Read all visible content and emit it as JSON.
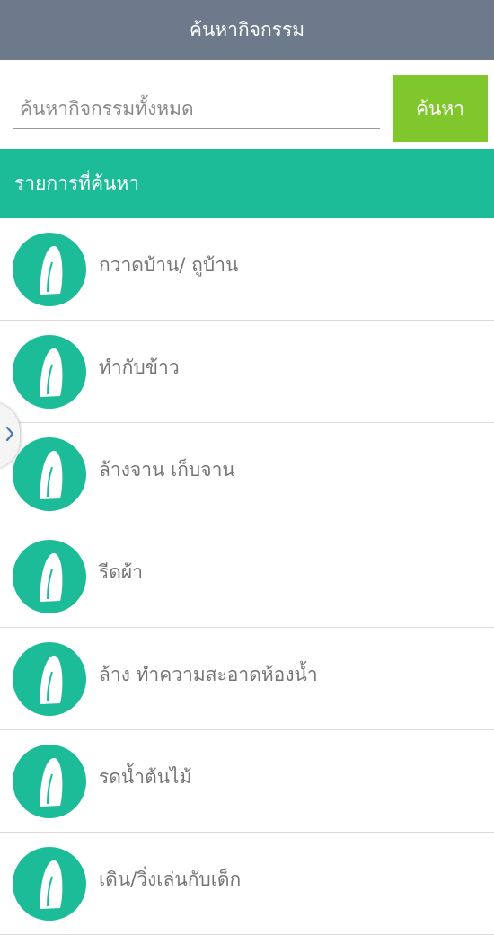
{
  "header": {
    "title": "ค้นหากิจกรรม"
  },
  "search": {
    "placeholder": "ค้นหากิจกรรมทั้งหมด",
    "value": "",
    "button_label": "ค้นหา"
  },
  "results_header": {
    "label": "รายการที่ค้นหา"
  },
  "items": [
    {
      "label": "กวาดบ้าน/ ถูบ้าน",
      "icon": "iron-icon"
    },
    {
      "label": "ทำกับข้าว",
      "icon": "iron-icon"
    },
    {
      "label": "ล้างจาน เก็บจาน",
      "icon": "iron-icon"
    },
    {
      "label": "รีดผ้า",
      "icon": "iron-icon"
    },
    {
      "label": "ล้าง ทำความสะอาดห้องน้ำ",
      "icon": "iron-icon"
    },
    {
      "label": "รดน้ำต้นไม้",
      "icon": "iron-icon"
    },
    {
      "label": "เดิน/วิ่งเล่นกับเด็ก",
      "icon": "iron-icon"
    }
  ],
  "side_handle": {
    "icon": "chevron-right-icon"
  },
  "colors": {
    "header": "#6c7a8c",
    "accent": "#1dbc98",
    "button": "#7fc72d"
  }
}
